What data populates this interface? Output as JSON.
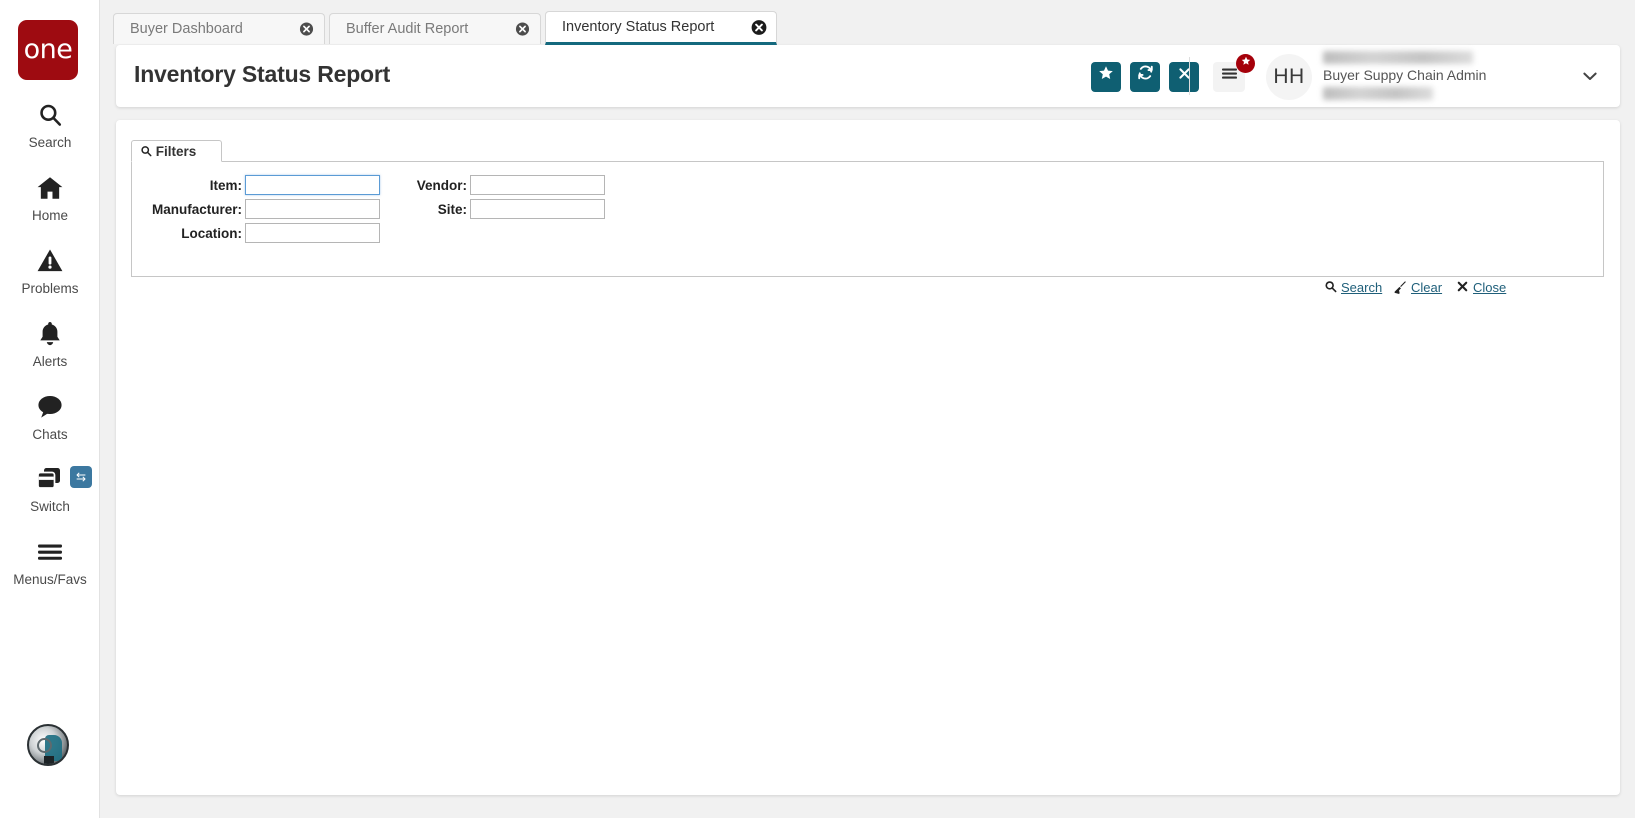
{
  "brand": {
    "logo_text": "one",
    "logo_color": "#9e0b11"
  },
  "theme": {
    "accent": "#0f5f72",
    "link": "#1f5f7a",
    "badge_red": "#a5000a",
    "focus_blue": "#5b9bd5"
  },
  "sidebar": {
    "items": [
      {
        "label": "Search",
        "icon": "search-icon"
      },
      {
        "label": "Home",
        "icon": "home-icon"
      },
      {
        "label": "Problems",
        "icon": "warning-triangle-icon"
      },
      {
        "label": "Alerts",
        "icon": "bell-icon"
      },
      {
        "label": "Chats",
        "icon": "chat-bubble-icon"
      },
      {
        "label": "Switch",
        "icon": "switch-windows-icon"
      },
      {
        "label": "Menus/Favs",
        "icon": "hamburger-icon"
      }
    ],
    "switch_badge_icon": "swap-arrows-icon",
    "assistant_icon": "ai-assistant-avatar"
  },
  "tabs": [
    {
      "label": "Buyer Dashboard",
      "active": false
    },
    {
      "label": "Buffer Audit Report",
      "active": false
    },
    {
      "label": "Inventory Status Report",
      "active": true
    }
  ],
  "header": {
    "title": "Inventory Status Report",
    "buttons": [
      {
        "name": "favorite-button",
        "icon": "star-icon"
      },
      {
        "name": "refresh-button",
        "icon": "refresh-icon"
      },
      {
        "name": "close-button",
        "icon": "x-icon"
      }
    ],
    "menus_icon": "hamburger-icon",
    "menus_badge_icon": "star-icon",
    "avatar_initials": "HH",
    "user_role": "Buyer Suppy Chain Admin",
    "caret_icon": "chevron-down-icon"
  },
  "filters": {
    "tab_label": "Filters",
    "tab_icon": "search-icon",
    "fields": [
      {
        "label": "Item:",
        "value": "",
        "placeholder": "",
        "focused": true
      },
      {
        "label": "Manufacturer:",
        "value": "",
        "placeholder": "",
        "focused": false
      },
      {
        "label": "Location:",
        "value": "",
        "placeholder": "",
        "focused": false
      },
      {
        "label": "Vendor:",
        "value": "",
        "placeholder": "",
        "focused": false
      },
      {
        "label": "Site:",
        "value": "",
        "placeholder": "",
        "focused": false
      }
    ],
    "actions": [
      {
        "label": "Search",
        "icon": "search-icon"
      },
      {
        "label": "Clear",
        "icon": "broom-icon"
      },
      {
        "label": "Close",
        "icon": "x-icon"
      }
    ]
  }
}
